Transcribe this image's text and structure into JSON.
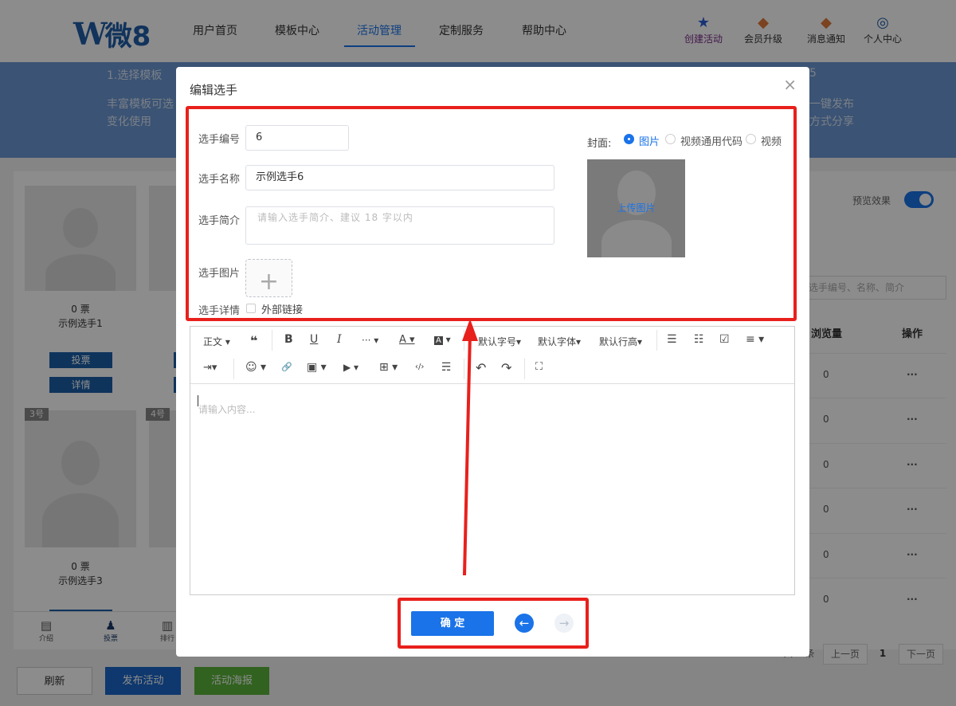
{
  "brand": {
    "w": "W",
    "name": "微8"
  },
  "nav": {
    "items": [
      "用户首页",
      "模板中心",
      "活动管理",
      "定制服务",
      "帮助中心"
    ],
    "active_index": 2
  },
  "right_nav": [
    {
      "label": "创建活动",
      "icon": "star-icon"
    },
    {
      "label": "会员升级",
      "icon": "vip-icon"
    },
    {
      "label": "消息通知",
      "icon": "bell-icon"
    },
    {
      "label": "个人中心",
      "icon": "user-icon"
    }
  ],
  "banner": {
    "step_title": "1.选择模板",
    "desc_line1": "丰富模板可选",
    "desc_line2": "变化使用",
    "right_line1": "一键发布",
    "right_line2": "方式分享",
    "step_right": "5"
  },
  "cards": [
    {
      "votes": "0 票",
      "name": "示例选手1",
      "vote_btn": "投票",
      "detail_btn": "详情"
    },
    {
      "num": "3号",
      "votes": "0 票",
      "name": "示例选手3"
    },
    {
      "num": "4号"
    }
  ],
  "tabbar": [
    "介绍",
    "投票",
    "排行"
  ],
  "right_panel": {
    "preview_label": "预览效果",
    "search_placeholder": "选手编号、名称、简介",
    "col_views": "浏览量",
    "col_actions": "操作",
    "rows": [
      {
        "views": "0",
        "action": "···"
      },
      {
        "views": "0",
        "action": "···"
      },
      {
        "views": "0",
        "action": "···"
      },
      {
        "views": "0",
        "action": "···"
      },
      {
        "views": "0",
        "action": "···"
      },
      {
        "views": "0",
        "action": "···"
      }
    ],
    "pager": {
      "total": "共 6 条",
      "prev": "上一页",
      "page": "1",
      "next": "下一页"
    }
  },
  "bottom_buttons": {
    "refresh": "刷新",
    "publish": "发布活动",
    "poster": "活动海报"
  },
  "bottom_colors": {
    "publish": "#1a66c8",
    "poster": "#5ab33a"
  },
  "modal": {
    "title": "编辑选手",
    "close": "×",
    "fields": {
      "number_label": "选手编号",
      "number_value": "6",
      "name_label": "选手名称",
      "name_value": "示例选手6",
      "intro_label": "选手简介",
      "intro_placeholder": "请输入选手简介、建议 18 字以内",
      "image_label": "选手图片",
      "image_plus": "+",
      "detail_label": "选手详情",
      "external_link_label": "外部链接"
    },
    "cover": {
      "label": "封面:",
      "options": [
        "图片",
        "视频通用代码",
        "视频"
      ],
      "selected_index": 0,
      "upload_text": "上传图片"
    },
    "toolbar": {
      "paragraph": "正文",
      "quote": "❝",
      "bold": "B",
      "underline": "U",
      "italic": "I",
      "more": "···",
      "font_color": "A",
      "bg_color": "A",
      "font_size": "默认字号",
      "font_family": "默认字体",
      "line_height": "默认行高",
      "ul": "☰",
      "ol": "☷",
      "todo": "☑",
      "align": "≡",
      "indent": "⇥",
      "emoji": "☺",
      "link": "🔗",
      "image": "▣",
      "video": "▶",
      "table": "⊞",
      "code": "‹/›",
      "divider": "☴",
      "undo": "↶",
      "redo": "↷",
      "fullscreen": "⛶"
    },
    "editor_placeholder": "请输入内容...",
    "confirm": "确 定",
    "prev_icon": "←",
    "next_icon": "→"
  },
  "colors": {
    "accent": "#1a73e8",
    "highlight": "#e8201c",
    "banner": "#6c97d3"
  }
}
